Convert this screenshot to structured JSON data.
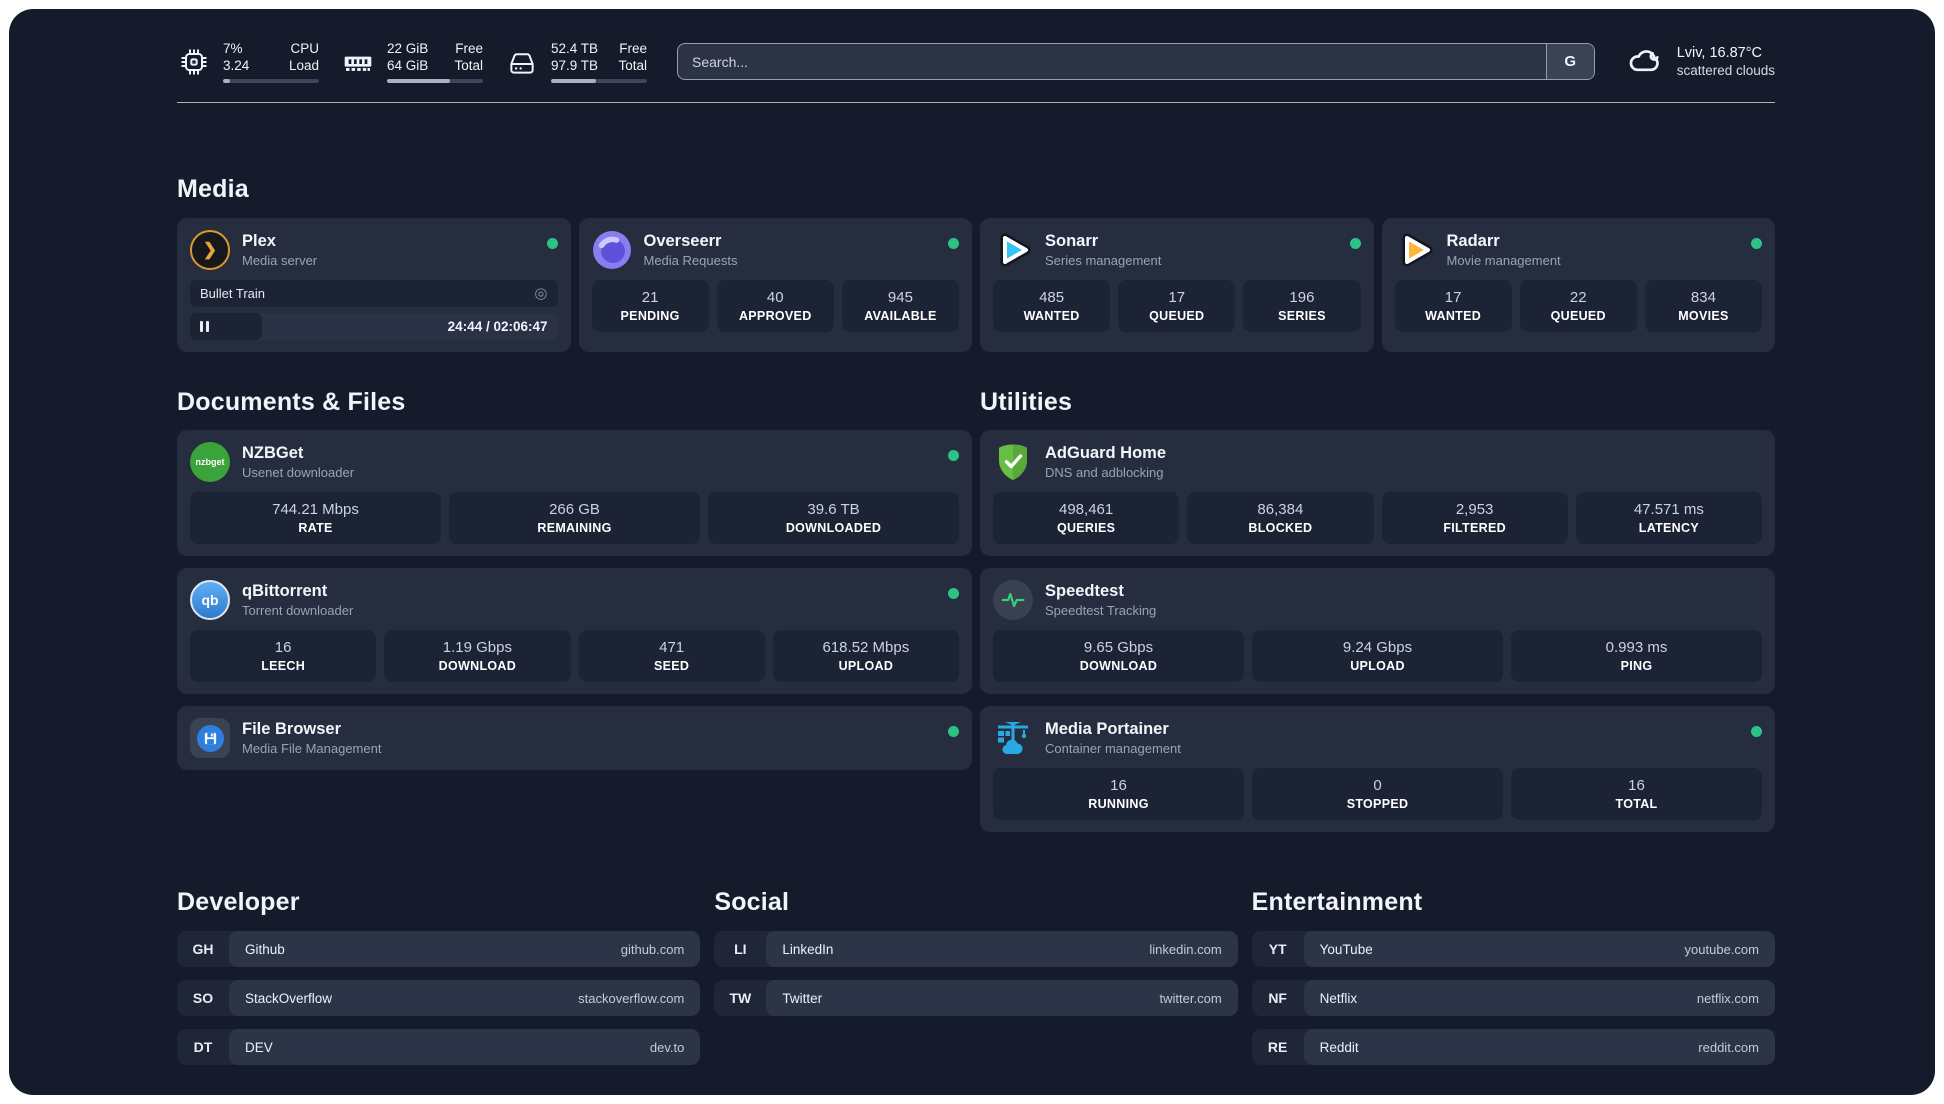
{
  "colors": {
    "background": "#161b2c",
    "card": "#262d3f",
    "stat_box": "#1c2334",
    "status_online": "#2bc284",
    "plex_amber": "#e8a33d",
    "sonarr_blue": "#36c3f1",
    "radarr_yellow": "#ffb53c",
    "adguard_green": "#68bd44",
    "portainer_blue": "#29a9e1"
  },
  "icons": {
    "plex_glyph": "❯",
    "disc_glyph": "◎"
  },
  "header": {
    "stats": [
      {
        "icon": "cpu-icon",
        "value_top": "7%",
        "value_bottom": "3.24",
        "label_top": "CPU",
        "label_bottom": "Load",
        "progress": "7%"
      },
      {
        "icon": "ram-icon",
        "value_top": "22 GiB",
        "value_bottom": "64 GiB",
        "label_top": "Free",
        "label_bottom": "Total",
        "progress": "66%"
      },
      {
        "icon": "disk-icon",
        "value_top": "52.4 TB",
        "value_bottom": "97.9 TB",
        "label_top": "Free",
        "label_bottom": "Total",
        "progress": "47%"
      }
    ],
    "search": {
      "placeholder": "Search...",
      "engine": "G"
    },
    "weather": {
      "summary": "Lviv, 16.87°C",
      "condition": "scattered clouds"
    }
  },
  "media": {
    "title": "Media",
    "apps": [
      {
        "name": "Plex",
        "subtitle": "Media server",
        "online": true,
        "player": {
          "title": "Bullet Train",
          "time": "24:44 / 02:06:47",
          "progress": "19.5%"
        }
      },
      {
        "name": "Overseerr",
        "subtitle": "Media Requests",
        "online": true,
        "stats": [
          {
            "value": "21",
            "label": "PENDING"
          },
          {
            "value": "40",
            "label": "APPROVED"
          },
          {
            "value": "945",
            "label": "AVAILABLE"
          }
        ]
      },
      {
        "name": "Sonarr",
        "subtitle": "Series management",
        "online": true,
        "stats": [
          {
            "value": "485",
            "label": "WANTED"
          },
          {
            "value": "17",
            "label": "QUEUED"
          },
          {
            "value": "196",
            "label": "SERIES"
          }
        ]
      },
      {
        "name": "Radarr",
        "subtitle": "Movie management",
        "online": true,
        "stats": [
          {
            "value": "17",
            "label": "WANTED"
          },
          {
            "value": "22",
            "label": "QUEUED"
          },
          {
            "value": "834",
            "label": "MOVIES"
          }
        ]
      }
    ]
  },
  "documents": {
    "title": "Documents & Files",
    "apps": [
      {
        "name": "NZBGet",
        "subtitle": "Usenet downloader",
        "icon_text": "nzbget",
        "online": true,
        "stats": [
          {
            "value": "744.21 Mbps",
            "label": "RATE"
          },
          {
            "value": "266 GB",
            "label": "REMAINING"
          },
          {
            "value": "39.6 TB",
            "label": "DOWNLOADED"
          }
        ]
      },
      {
        "name": "qBittorrent",
        "subtitle": "Torrent downloader",
        "icon_text": "qb",
        "online": true,
        "stats": [
          {
            "value": "16",
            "label": "LEECH"
          },
          {
            "value": "1.19 Gbps",
            "label": "DOWNLOAD"
          },
          {
            "value": "471",
            "label": "SEED"
          },
          {
            "value": "618.52 Mbps",
            "label": "UPLOAD"
          }
        ]
      },
      {
        "name": "File Browser",
        "subtitle": "Media File Management",
        "online": true
      }
    ]
  },
  "utilities": {
    "title": "Utilities",
    "apps": [
      {
        "name": "AdGuard Home",
        "subtitle": "DNS and adblocking",
        "stats": [
          {
            "value": "498,461",
            "label": "QUERIES"
          },
          {
            "value": "86,384",
            "label": "BLOCKED"
          },
          {
            "value": "2,953",
            "label": "FILTERED"
          },
          {
            "value": "47.571 ms",
            "label": "LATENCY"
          }
        ]
      },
      {
        "name": "Speedtest",
        "subtitle": "Speedtest Tracking",
        "stats": [
          {
            "value": "9.65 Gbps",
            "label": "DOWNLOAD"
          },
          {
            "value": "9.24 Gbps",
            "label": "UPLOAD"
          },
          {
            "value": "0.993 ms",
            "label": "PING"
          }
        ]
      },
      {
        "name": "Media Portainer",
        "subtitle": "Container management",
        "online": true,
        "stats": [
          {
            "value": "16",
            "label": "RUNNING"
          },
          {
            "value": "0",
            "label": "STOPPED"
          },
          {
            "value": "16",
            "label": "TOTAL"
          }
        ]
      }
    ]
  },
  "bookmarks": [
    {
      "title": "Developer",
      "items": [
        {
          "abbr": "GH",
          "name": "Github",
          "url": "github.com"
        },
        {
          "abbr": "SO",
          "name": "StackOverflow",
          "url": "stackoverflow.com"
        },
        {
          "abbr": "DT",
          "name": "DEV",
          "url": "dev.to"
        }
      ]
    },
    {
      "title": "Social",
      "items": [
        {
          "abbr": "LI",
          "name": "LinkedIn",
          "url": "linkedin.com"
        },
        {
          "abbr": "TW",
          "name": "Twitter",
          "url": "twitter.com"
        }
      ]
    },
    {
      "title": "Entertainment",
      "items": [
        {
          "abbr": "YT",
          "name": "YouTube",
          "url": "youtube.com"
        },
        {
          "abbr": "NF",
          "name": "Netflix",
          "url": "netflix.com"
        },
        {
          "abbr": "RE",
          "name": "Reddit",
          "url": "reddit.com"
        }
      ]
    }
  ]
}
